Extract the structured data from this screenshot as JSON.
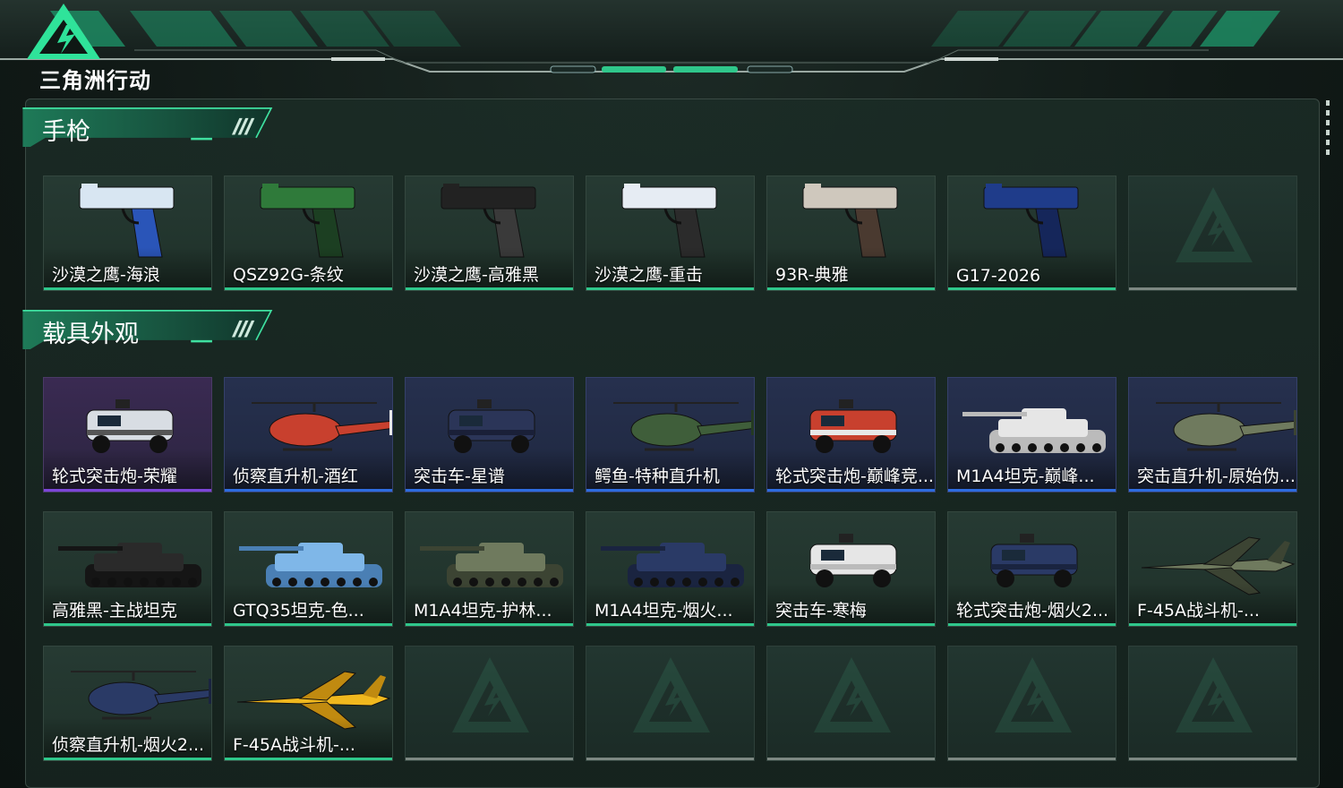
{
  "brand": {
    "logo_text": "三角洲行动",
    "accent": "#2fc78b"
  },
  "sections": {
    "pistols": {
      "title": "手枪",
      "items": [
        {
          "label": "沙漠之鹰-海浪",
          "rarity": "green",
          "icon": "desert-eagle-blue-icon"
        },
        {
          "label": "QSZ92G-条纹",
          "rarity": "green",
          "icon": "qsz92g-green-icon"
        },
        {
          "label": "沙漠之鹰-高雅黑",
          "rarity": "green",
          "icon": "desert-eagle-black-icon"
        },
        {
          "label": "沙漠之鹰-重击",
          "rarity": "green",
          "icon": "desert-eagle-white-icon"
        },
        {
          "label": "93R-典雅",
          "rarity": "green",
          "icon": "pistol-93r-icon"
        },
        {
          "label": "G17-2026",
          "rarity": "green",
          "icon": "g17-blue-icon"
        }
      ]
    },
    "vehicles": {
      "title": "载具外观",
      "items": [
        {
          "label": "轮式突击炮-荣耀",
          "rarity": "purple",
          "icon": "wheeled-assault-gun-icon"
        },
        {
          "label": "侦察直升机-酒红",
          "rarity": "blue",
          "icon": "scout-helicopter-red-icon"
        },
        {
          "label": "突击车-星谱",
          "rarity": "blue",
          "icon": "assault-vehicle-blue-icon"
        },
        {
          "label": "鳄鱼-特种直升机",
          "rarity": "blue",
          "icon": "attack-helicopter-green-icon"
        },
        {
          "label": "轮式突击炮-巅峰竞...",
          "rarity": "blue",
          "icon": "wheeled-assault-gun-red-icon"
        },
        {
          "label": "M1A4坦克-巅峰...",
          "rarity": "blue",
          "icon": "tank-red-white-icon"
        },
        {
          "label": "突击直升机-原始伪...",
          "rarity": "blue",
          "icon": "attack-helicopter-camo-icon"
        },
        {
          "label": "高雅黑-主战坦克",
          "rarity": "green",
          "icon": "tank-black-icon"
        },
        {
          "label": "GTQ35坦克-色...",
          "rarity": "green",
          "icon": "tank-lightblue-icon"
        },
        {
          "label": "M1A4坦克-护林...",
          "rarity": "green",
          "icon": "tank-camo-icon"
        },
        {
          "label": "M1A4坦克-烟火...",
          "rarity": "green",
          "icon": "tank-navy-icon"
        },
        {
          "label": "突击车-寒梅",
          "rarity": "green",
          "icon": "assault-vehicle-white-icon"
        },
        {
          "label": "轮式突击炮-烟火2...",
          "rarity": "green",
          "icon": "wheeled-assault-gun-navy-icon"
        },
        {
          "label": "F-45A战斗机-...",
          "rarity": "green",
          "icon": "fighter-jet-camo-icon"
        },
        {
          "label": "侦察直升机-烟火2...",
          "rarity": "green",
          "icon": "scout-helicopter-navy-icon"
        },
        {
          "label": "F-45A战斗机-...",
          "rarity": "green",
          "icon": "fighter-jet-yellow-icon"
        }
      ]
    }
  },
  "colors": {
    "rarity_green": "#2fc78b",
    "rarity_blue": "#2e6ce0",
    "rarity_purple": "#7c46d8",
    "empty_slot": "#7d8882"
  }
}
